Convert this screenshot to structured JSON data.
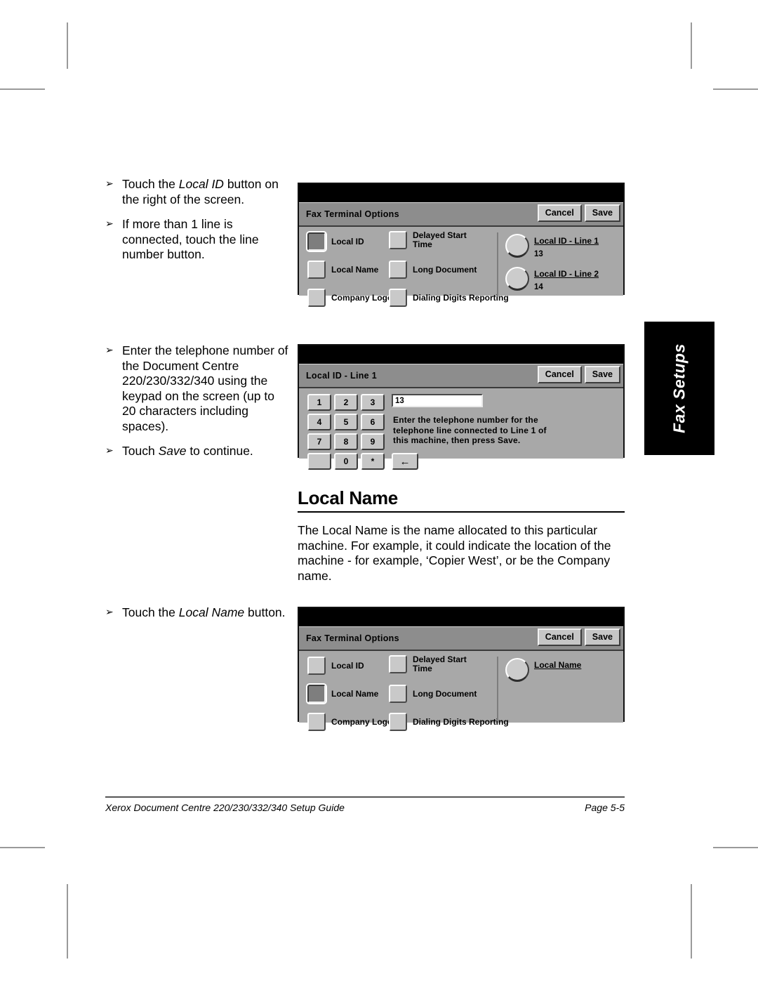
{
  "notes": {
    "note1": [
      {
        "prefix": "Touch the ",
        "emphasis": "Local ID",
        "suffix": " button on the right of the screen."
      },
      {
        "prefix": "If more than 1 line is connected, touch the line number button.",
        "emphasis": "",
        "suffix": ""
      }
    ],
    "note2": [
      {
        "prefix": "Enter the telephone number of the Document Centre 220/230/332/340 using the keypad on the screen (up to 20 characters including spaces).",
        "emphasis": "",
        "suffix": ""
      },
      {
        "prefix": "Touch ",
        "emphasis": "Save",
        "suffix": " to continue."
      }
    ],
    "note3": [
      {
        "prefix": "Touch the ",
        "emphasis": "Local Name",
        "suffix": " button."
      }
    ]
  },
  "section": {
    "heading": "Local Name",
    "paragraph": "The Local Name is the name allocated to this particular machine. For example, it could indicate the location of the machine - for example, ‘Copier West’, or be the Company name."
  },
  "thumb_tab": {
    "label": "Fax Setups"
  },
  "footer": {
    "left": "Xerox Document Centre 220/230/332/340 Setup Guide",
    "right": "Page 5-5"
  },
  "screens": {
    "fax_terminal_options_1": {
      "title": "Fax Terminal Options",
      "cancel": "Cancel",
      "save": "Save",
      "options_col1": [
        {
          "label": "Local ID",
          "selected": true
        },
        {
          "label": "Local Name",
          "selected": false
        },
        {
          "label": "Company Logo",
          "selected": false
        }
      ],
      "options_col2": [
        {
          "label": "Delayed Start\nTime",
          "selected": false
        },
        {
          "label": "Long Document",
          "selected": false
        },
        {
          "label": "Dialing Digits Reporting",
          "selected": false
        }
      ],
      "round_buttons": [
        {
          "title": "Local ID - Line 1",
          "sub": "13"
        },
        {
          "title": "Local ID - Line 2",
          "sub": "14"
        }
      ]
    },
    "local_id_line_1": {
      "title": "Local ID - Line 1",
      "cancel": "Cancel",
      "save": "Save",
      "keys": [
        "1",
        "2",
        "3",
        "4",
        "5",
        "6",
        "7",
        "8",
        "9",
        "",
        "0",
        "*"
      ],
      "backspace_glyph": "←",
      "entry_value": "13",
      "instruction": "Enter the telephone number for the\ntelephone line connected to Line 1 of\nthis machine, then press Save."
    },
    "fax_terminal_options_2": {
      "title": "Fax Terminal Options",
      "cancel": "Cancel",
      "save": "Save",
      "options_col1": [
        {
          "label": "Local ID",
          "selected": false
        },
        {
          "label": "Local Name",
          "selected": true
        },
        {
          "label": "Company Logo",
          "selected": false
        }
      ],
      "options_col2": [
        {
          "label": "Delayed Start\nTime",
          "selected": false
        },
        {
          "label": "Long Document",
          "selected": false
        },
        {
          "label": "Dialing Digits Reporting",
          "selected": false
        }
      ],
      "round_buttons": [
        {
          "title": "Local Name",
          "sub": ""
        }
      ]
    }
  }
}
